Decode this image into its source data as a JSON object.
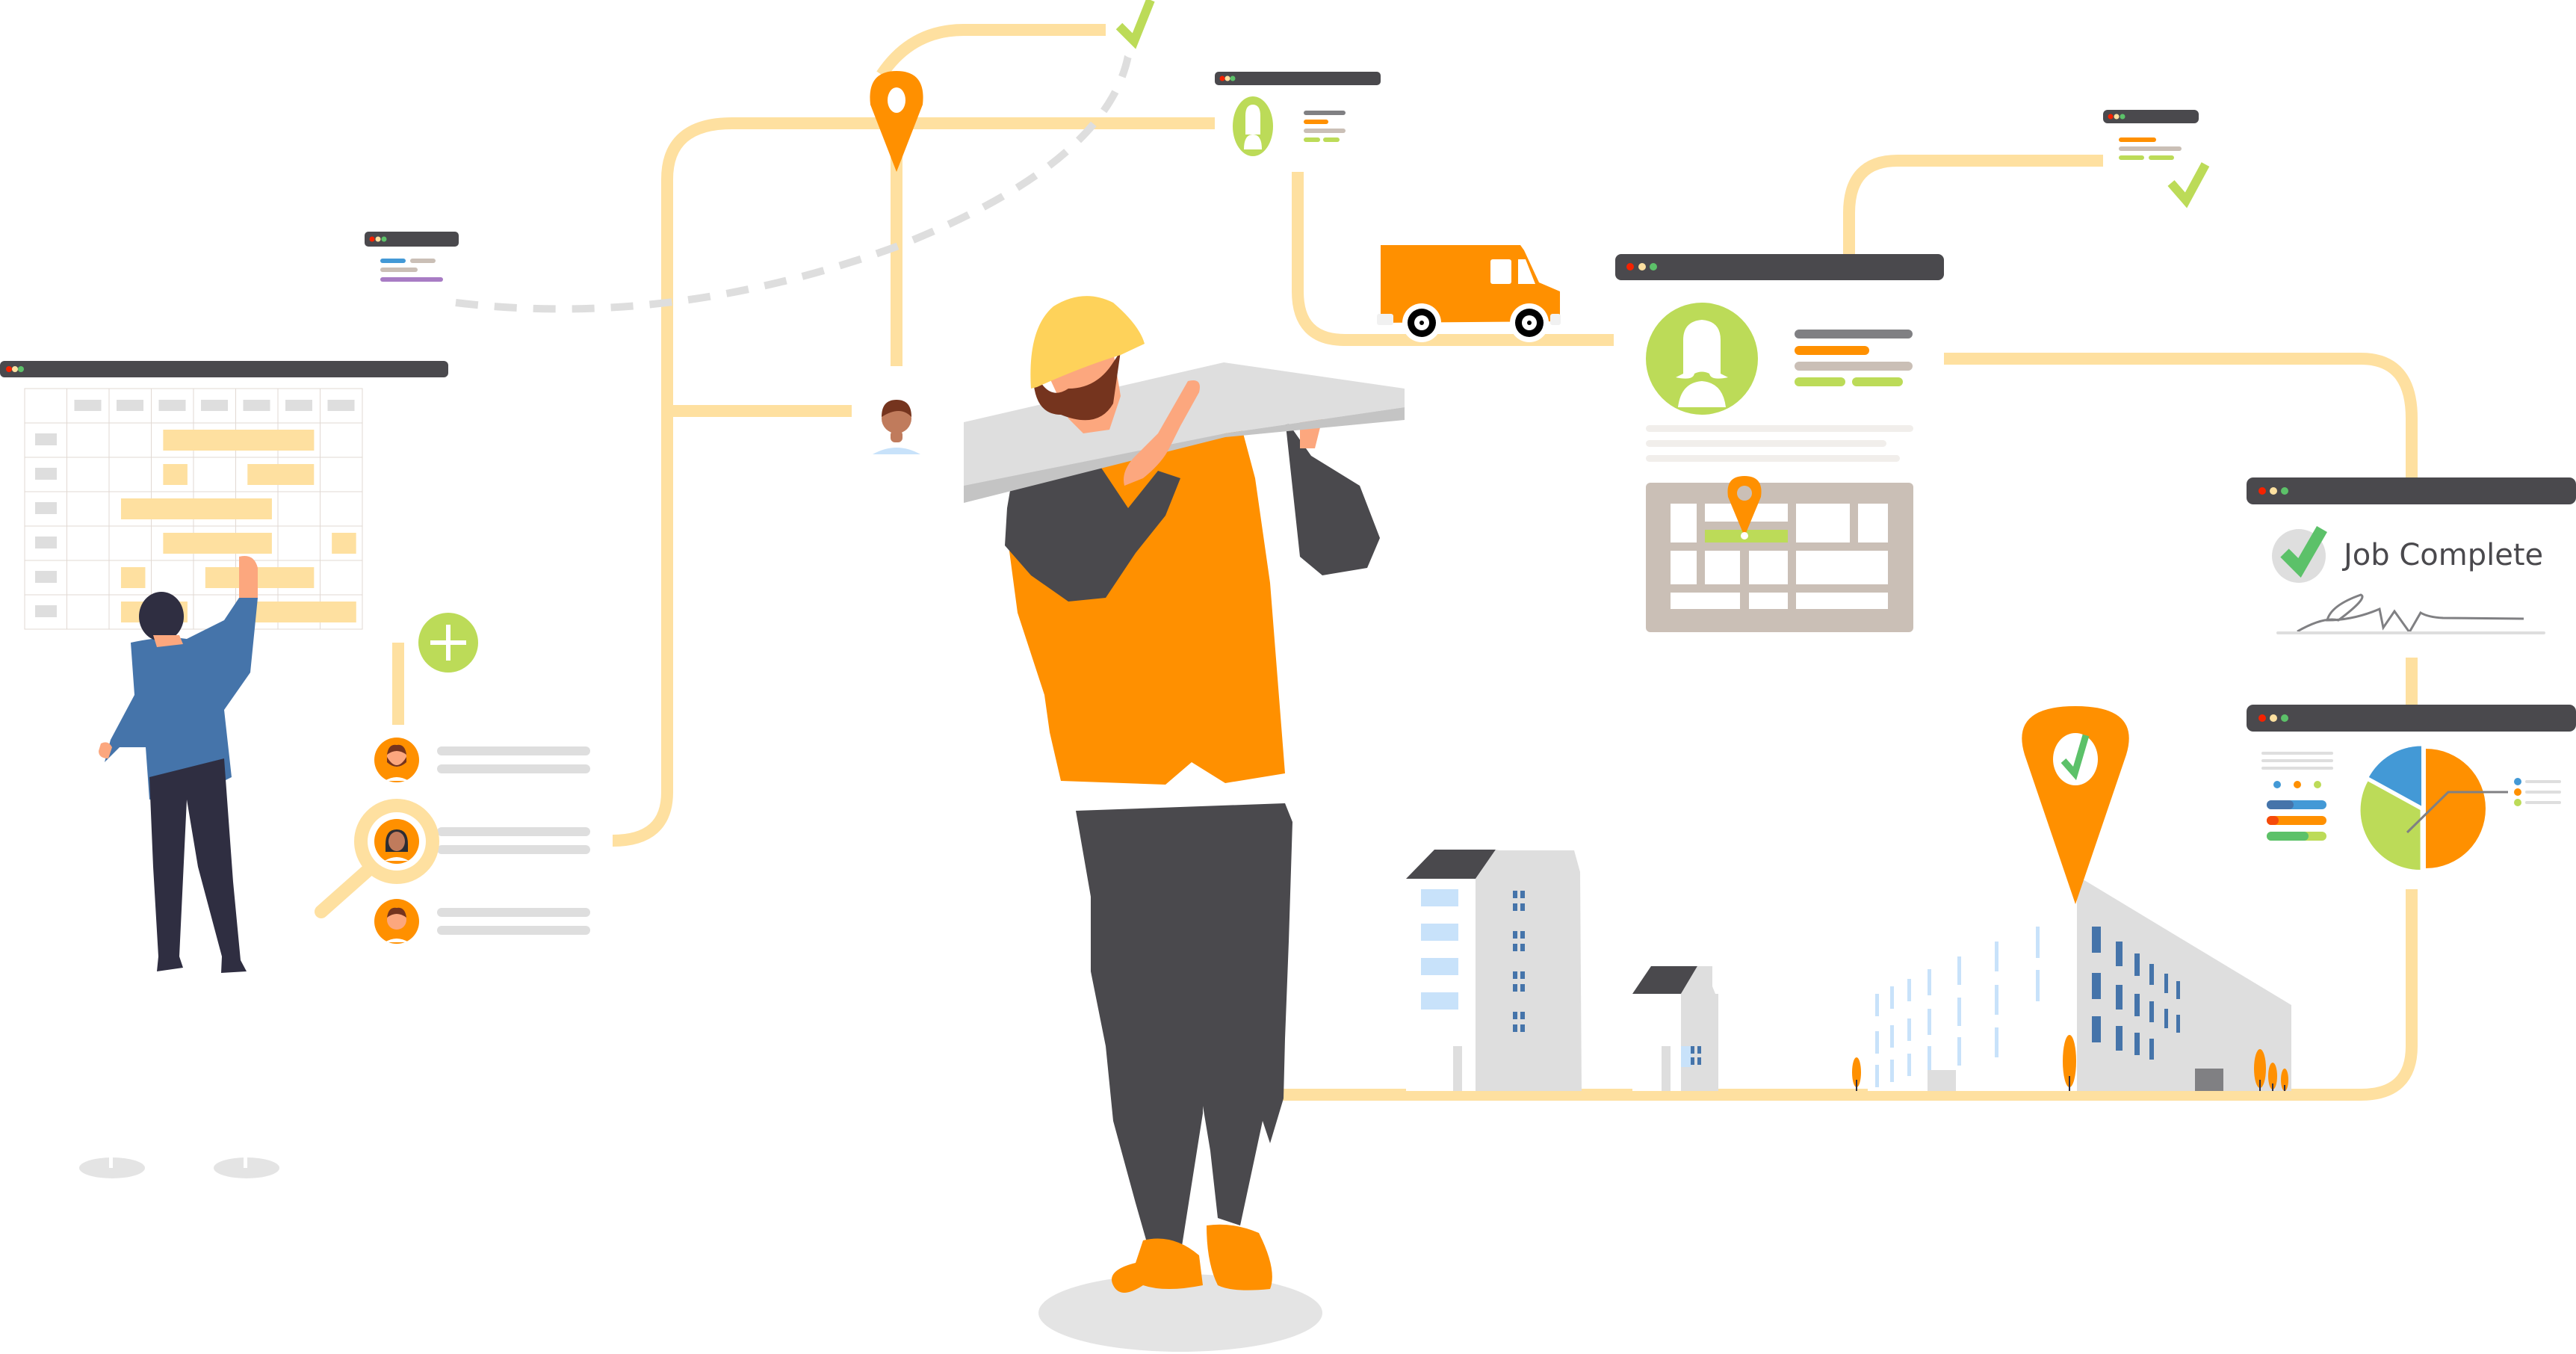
{
  "colors": {
    "path": "#fee0a0",
    "orange": "#ff9000",
    "green": "#bcdb58",
    "check_green": "#5cc169",
    "dark": "#4a494d",
    "titlebar": "#4a494d",
    "dot_red": "#f52200",
    "dot_yellow": "#fde0a0",
    "dot_green": "#5cc169",
    "gray_line": "#dedede",
    "tan": "#cabfb6",
    "blue": "#4399d6",
    "dark_blue": "#4574aa",
    "light_blue": "#c8e2fa",
    "purple": "#a87cc4",
    "skin": "#fca77e",
    "beard": "#75341e",
    "helmet": "#fed25a"
  },
  "job_complete": {
    "label": "Job Complete"
  },
  "schedule": {
    "rows": 6,
    "columns": 7,
    "bookings": [
      [
        0,
        0,
        1,
        1,
        1,
        1,
        0,
        0
      ],
      [
        0,
        0,
        1,
        0,
        1,
        1,
        0,
        0
      ],
      [
        0,
        1,
        1,
        1,
        1,
        0,
        0,
        0
      ],
      [
        0,
        0,
        1,
        1,
        1,
        0,
        1,
        0
      ],
      [
        0,
        1,
        0,
        1,
        1,
        1,
        0,
        0
      ],
      [
        0,
        1,
        1,
        0,
        1,
        1,
        1,
        0
      ]
    ]
  },
  "technicians": [
    {
      "name": "technician-bearded",
      "selected": false
    },
    {
      "name": "technician-female",
      "selected": true
    },
    {
      "name": "technician-young",
      "selected": false
    }
  ],
  "chart_data": {
    "type": "pie",
    "title": "",
    "categories": [
      "blue",
      "orange",
      "green"
    ],
    "values": [
      17,
      50,
      33
    ],
    "colors": [
      "#4399d6",
      "#ff9000",
      "#bcdb58"
    ],
    "legend": "right",
    "bars": [
      {
        "color_dark": "#4574aa",
        "color_light": "#4399d6",
        "fraction": 0.45
      },
      {
        "color_dark": "#f54a0a",
        "color_light": "#ff9000",
        "fraction": 0.2
      },
      {
        "color_dark": "#5cc169",
        "color_light": "#bcdb58",
        "fraction": 0.7
      }
    ]
  }
}
